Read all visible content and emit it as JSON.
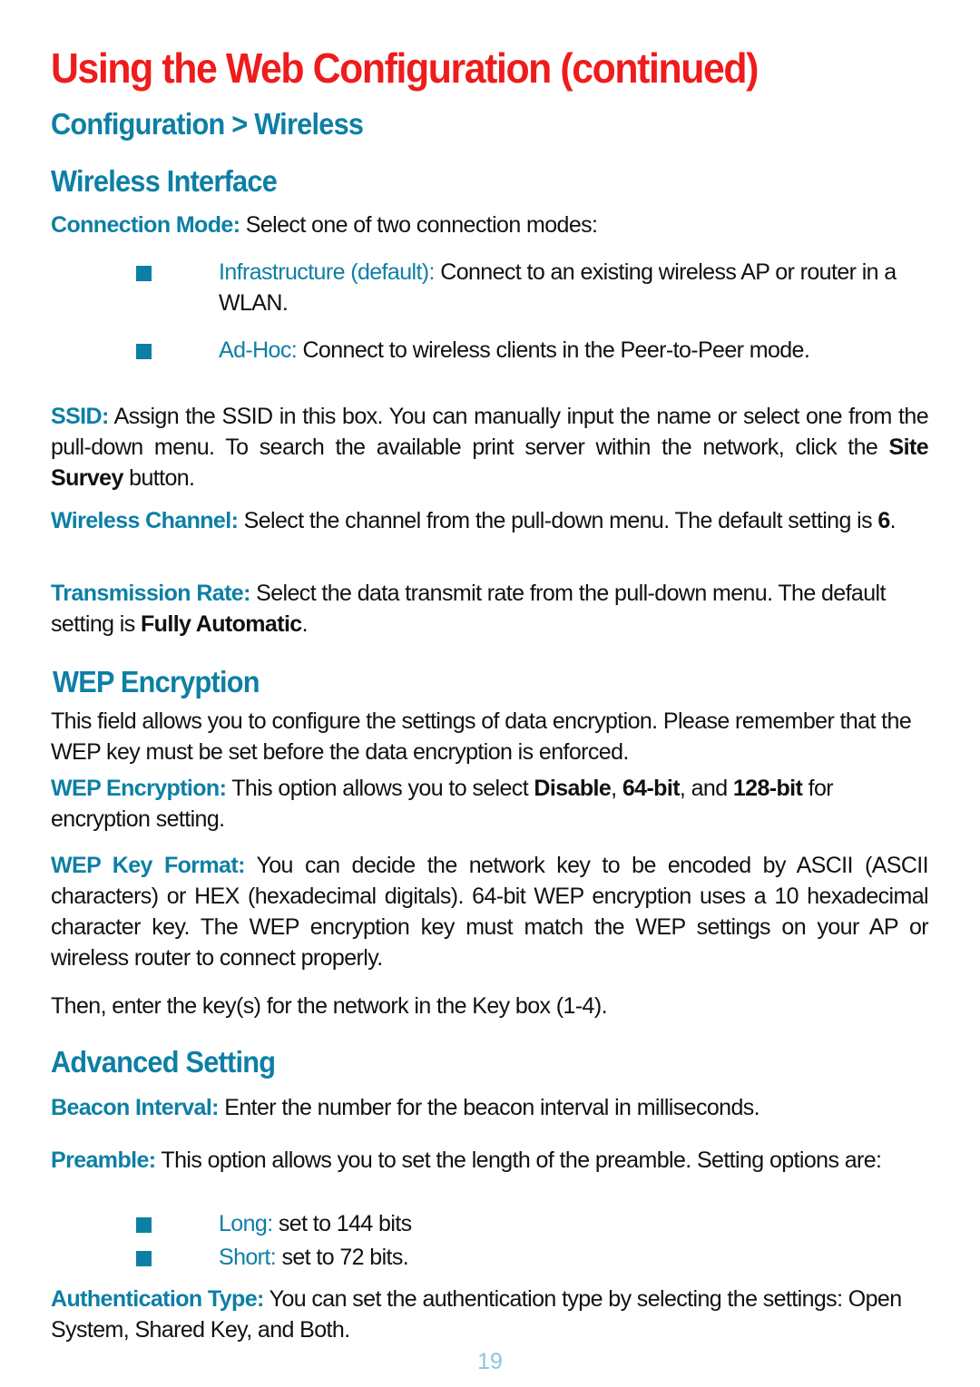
{
  "page_title": "Using the Web Configuration (continued)",
  "breadcrumb": "Configuration > Wireless",
  "sections": {
    "wireless_interface": {
      "heading": "Wireless Interface",
      "connection_mode": {
        "label": "Connection Mode:",
        "text": " Select one of two connection modes:",
        "options": [
          {
            "label": "Infrastructure (default):",
            "text": " Connect to an existing wireless AP or router in a WLAN."
          },
          {
            "label": "Ad-Hoc:",
            "text": " Connect to wireless clients in the Peer-to-Peer mode."
          }
        ]
      },
      "ssid": {
        "label": "SSID:",
        "text_before": " Assign the SSID in this box. You can manually input the name or select one from the pull-down menu. To search the available print server within the network, click the ",
        "bold": "Site Survey",
        "text_after": " button."
      },
      "wireless_channel": {
        "label": "Wireless Channel:",
        "text_before": " Select the channel from the pull-down menu. The default setting is ",
        "bold": "6",
        "text_after": "."
      },
      "transmission_rate": {
        "label": "Transmission Rate:",
        "text_before": " Select the data transmit rate from the pull-down menu. The default setting is ",
        "bold": "Fully Automatic",
        "text_after": "."
      }
    },
    "wep_encryption": {
      "heading": "WEP Encryption",
      "intro": "This field allows you to configure the settings of data encryption. Please remember that the WEP key must be set before the data encryption is enforced.",
      "wep_encryption_item": {
        "label": "WEP Encryption:",
        "text1": " This option allows you to select ",
        "bold1": "Disable",
        "sep1": ", ",
        "bold2": "64-bit",
        "sep2": ", and ",
        "bold3": "128-bit",
        "text2": " for encryption setting."
      },
      "wep_key_format": {
        "label": "WEP Key Format:",
        "text": " You can decide the network key to be encoded by ASCII (ASCII characters) or HEX (hexadecimal digitals). 64-bit WEP encryption uses a 10 hexadecimal character key. The WEP encryption key must match the WEP settings on your AP or wireless router to connect properly."
      },
      "key_note": "Then, enter the key(s) for the network in the Key box (1-4)."
    },
    "advanced_setting": {
      "heading": "Advanced Setting",
      "beacon_interval": {
        "label": "Beacon Interval:",
        "text": " Enter the number for the beacon interval in milliseconds."
      },
      "preamble": {
        "label": "Preamble:",
        "text": " This option allows you to set the length of the preamble. Setting options are:",
        "options": [
          {
            "label": "Long:",
            "text": " set to 144 bits"
          },
          {
            "label": "Short:",
            "text": " set to 72 bits."
          }
        ]
      },
      "authentication_type": {
        "label": "Authentication Type:",
        "text": " You can set the authentication type by selecting the settings: Open System, Shared Key, and Both."
      }
    }
  },
  "page_number": "19",
  "colors": {
    "title": "#ee1c1c",
    "accent": "#0d7fa5",
    "page_number": "#8cc6dc"
  }
}
